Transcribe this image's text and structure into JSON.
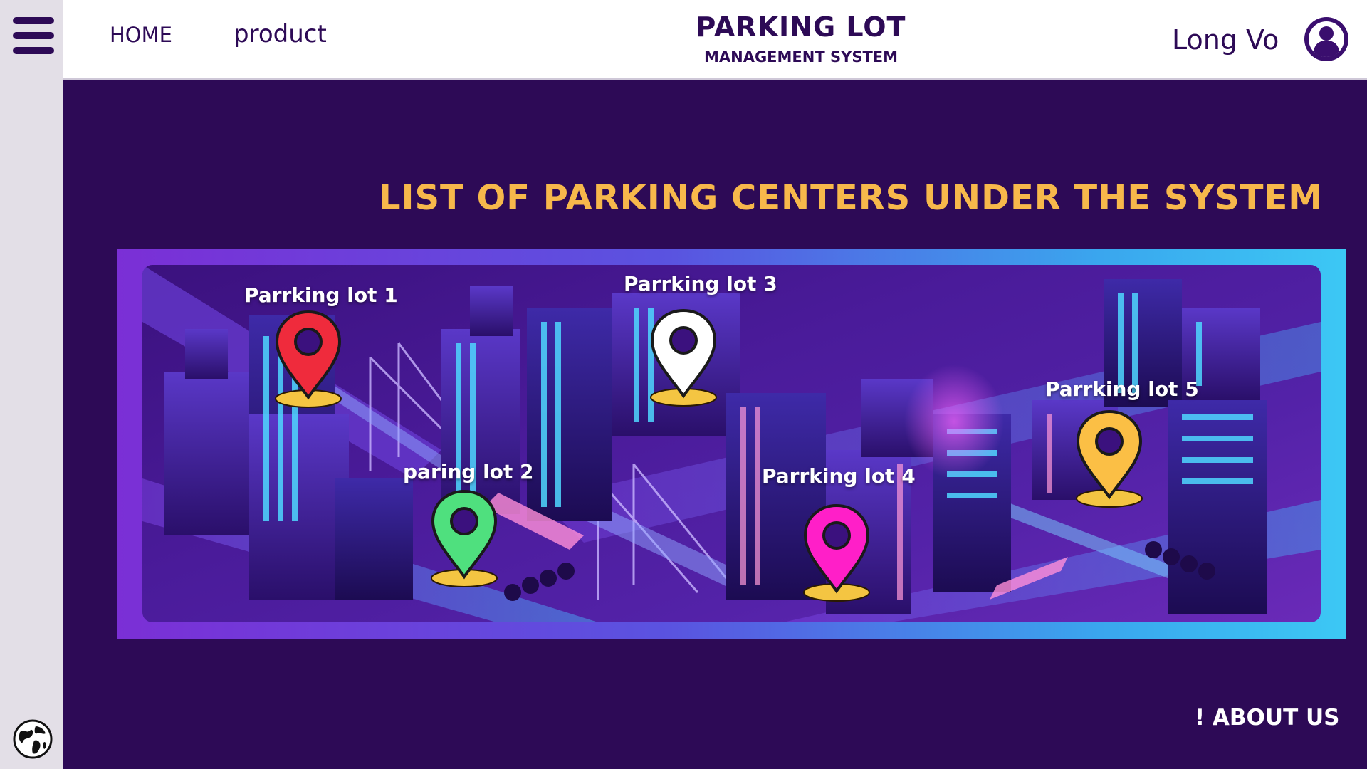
{
  "nav": {
    "home": "HOME",
    "product": "product"
  },
  "brand": {
    "title": "PARKING LOT",
    "subtitle": "MANAGEMENT SYSTEM"
  },
  "user": {
    "name": "Long Vo"
  },
  "main": {
    "title": "LIST OF PARKING CENTERS UNDER THE SYSTEM"
  },
  "lots": [
    {
      "label": "Parrking lot 1",
      "color": "#ef2b3c"
    },
    {
      "label": "paring lot 2",
      "color": "#4fe07e"
    },
    {
      "label": "Parrking lot 3",
      "color": "#ffffff"
    },
    {
      "label": "Parrking lot  4",
      "color": "#ff1fc8"
    },
    {
      "label": "Parrking lot 5",
      "color": "#fbbf45"
    }
  ],
  "footer": {
    "about": "! ABOUT US"
  },
  "colors": {
    "background": "#2d0a56",
    "title_accent": "#f7b84b",
    "sidebar": "#e3dfe7"
  },
  "icons": {
    "menu": "hamburger-menu-icon",
    "globe": "globe-icon",
    "user": "user-avatar-icon",
    "pin": "map-pin-icon"
  }
}
